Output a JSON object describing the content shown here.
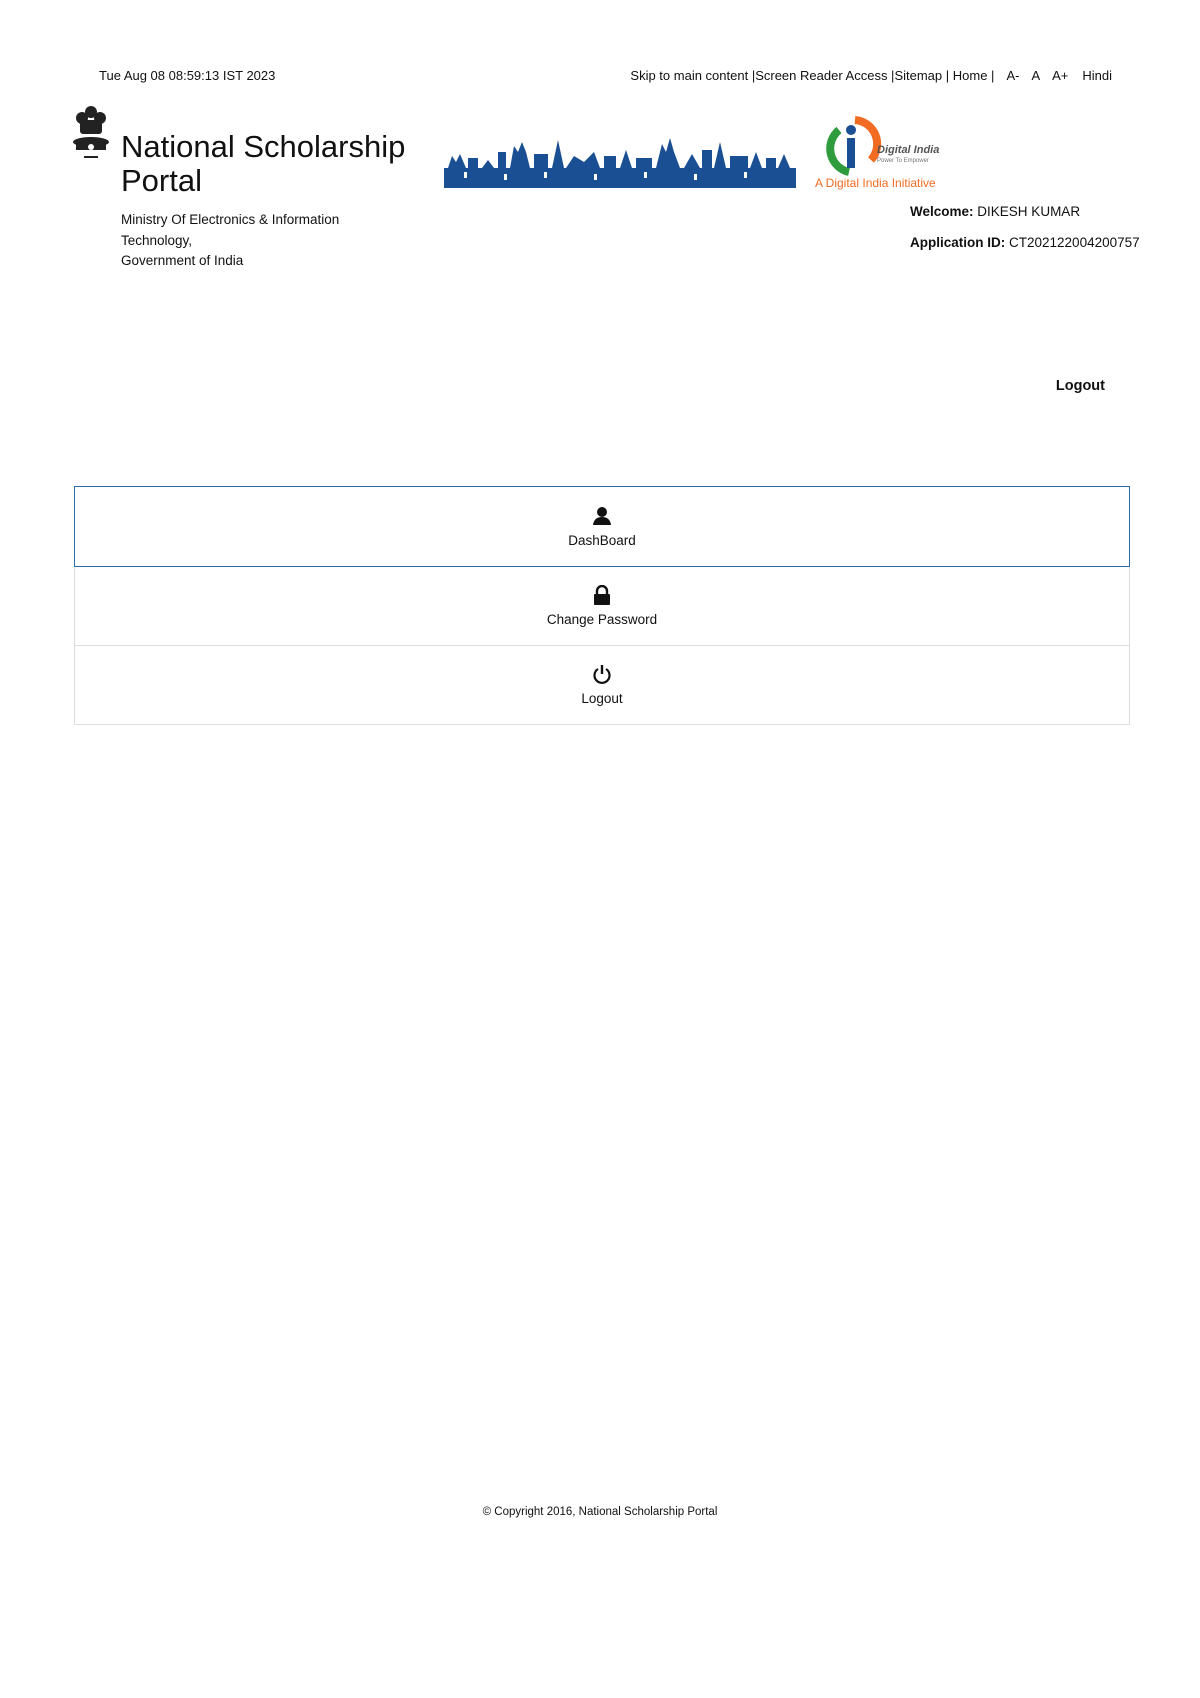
{
  "header": {
    "datetime": "Tue Aug 08 08:59:13 IST 2023",
    "links": {
      "skip": "Skip to main content",
      "screen_reader": "Screen Reader Access",
      "sitemap": "Sitemap",
      "home": "Home",
      "font_decrease": "A-",
      "font_normal": "A",
      "font_increase": "A+",
      "language": "Hindi"
    },
    "portal_title": "National Scholarship Portal",
    "ministry_line1": "Ministry Of Electronics & Information",
    "ministry_line2": "Technology,",
    "ministry_line3": "Government of India",
    "digital_india": {
      "logo_text": "Digital India",
      "tagline": "Power To Empower",
      "initiative": "A Digital India Initiative"
    }
  },
  "user": {
    "welcome_label": "Welcome:",
    "name": "DIKESH KUMAR",
    "app_id_label": "Application ID:",
    "app_id": "CT202122004200757"
  },
  "logout_link": "Logout",
  "menu": {
    "items": [
      {
        "label": "DashBoard",
        "icon": "user-icon"
      },
      {
        "label": "Change Password",
        "icon": "lock-icon"
      },
      {
        "label": "Logout",
        "icon": "power-icon"
      }
    ]
  },
  "footer": {
    "copyright": "© Copyright 2016, National Scholarship Portal"
  },
  "colors": {
    "accent_border": "#2a6db0",
    "banner_blue": "#1b4f93",
    "di_orange": "#f26b22",
    "di_green": "#2e9b3d"
  }
}
